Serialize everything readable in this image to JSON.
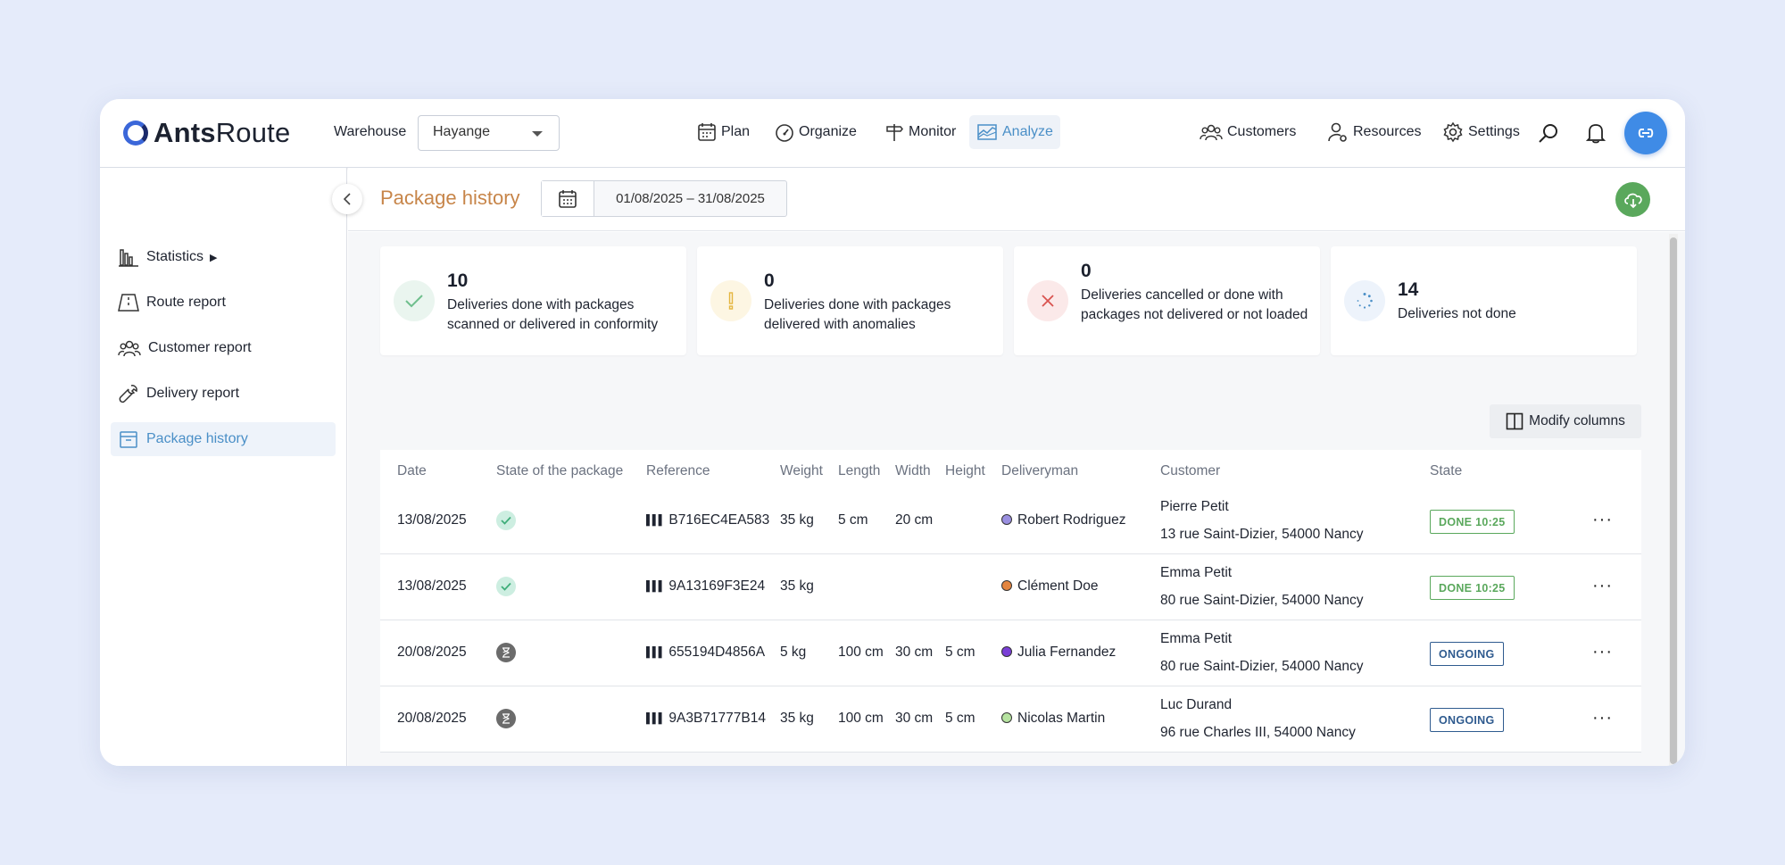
{
  "app": {
    "logo_bold": "Ants",
    "logo_light": "Route"
  },
  "header": {
    "warehouse_label": "Warehouse",
    "warehouse_value": "Hayange",
    "nav": [
      {
        "label": "Plan",
        "icon": "calendar-icon"
      },
      {
        "label": "Organize",
        "icon": "gauge-icon"
      },
      {
        "label": "Monitor",
        "icon": "signpost-icon"
      },
      {
        "label": "Analyze",
        "icon": "chart-icon"
      }
    ],
    "right_nav": [
      {
        "label": "Customers",
        "icon": "users-icon"
      },
      {
        "label": "Resources",
        "icon": "user-gear-icon"
      },
      {
        "label": "Settings",
        "icon": "gear-icon"
      }
    ],
    "avatar_icon": "link-icon"
  },
  "sidebar": {
    "items": [
      {
        "label": "Statistics",
        "icon": "bar-chart-icon",
        "has_submenu": true
      },
      {
        "label": "Route report",
        "icon": "road-icon"
      },
      {
        "label": "Customer report",
        "icon": "users-icon"
      },
      {
        "label": "Delivery report",
        "icon": "wrench-icon"
      },
      {
        "label": "Package history",
        "icon": "package-icon",
        "active": true
      }
    ],
    "submenu_marker": "▶"
  },
  "page": {
    "title": "Package history",
    "date_range": "01/08/2025 – 31/08/2025"
  },
  "summary": [
    {
      "value": "10",
      "text": "Deliveries done with packages scanned or delivered in conformity",
      "icon": "check-icon",
      "color": "#5aa85c"
    },
    {
      "value": "0",
      "text": "Deliveries done with packages delivered with anomalies",
      "icon": "exclamation-icon",
      "color": "#e4b640"
    },
    {
      "value": "0",
      "text": "Deliveries cancelled or done with packages not delivered or not loaded",
      "icon": "cross-icon",
      "color": "#d9534f"
    },
    {
      "value": "14",
      "text": "Deliveries not done",
      "icon": "loading-icon",
      "color": "#4a8fc7"
    }
  ],
  "modify_columns_label": "Modify columns",
  "table": {
    "columns": [
      "Date",
      "State of the package",
      "Reference",
      "Weight",
      "Length",
      "Width",
      "Height",
      "Deliveryman",
      "Customer",
      "State"
    ],
    "rows": [
      {
        "date": "13/08/2025",
        "pkg_state": "ok",
        "reference": "B716EC4EA583",
        "weight": "35 kg",
        "length": "5 cm",
        "width": "20 cm",
        "height": "",
        "deliveryman": "Robert Rodriguez",
        "dot_color": "#9a8fe0",
        "customer_name": "Pierre Petit",
        "customer_address": "13 rue Saint-Dizier, 54000 Nancy",
        "state": "DONE 10:25",
        "state_type": "done"
      },
      {
        "date": "13/08/2025",
        "pkg_state": "ok",
        "reference": "9A13169F3E24",
        "weight": "35 kg",
        "length": "",
        "width": "",
        "height": "",
        "deliveryman": "Clément Doe",
        "dot_color": "#e3853f",
        "customer_name": "Emma Petit",
        "customer_address": "80 rue Saint-Dizier, 54000 Nancy",
        "state": "DONE 10:25",
        "state_type": "done"
      },
      {
        "date": "20/08/2025",
        "pkg_state": "waiting",
        "reference": "655194D4856A",
        "weight": "5 kg",
        "length": "100 cm",
        "width": "30 cm",
        "height": "5 cm",
        "deliveryman": "Julia Fernandez",
        "dot_color": "#7a3fd6",
        "customer_name": "Emma Petit",
        "customer_address": "80 rue Saint-Dizier, 54000 Nancy",
        "state": "ONGOING",
        "state_type": "ongoing"
      },
      {
        "date": "20/08/2025",
        "pkg_state": "waiting",
        "reference": "9A3B71777B14",
        "weight": "35 kg",
        "length": "100 cm",
        "width": "30 cm",
        "height": "5 cm",
        "deliveryman": "Nicolas Martin",
        "dot_color": "#b6e3a0",
        "customer_name": "Luc Durand",
        "customer_address": "96 rue Charles III, 54000 Nancy",
        "state": "ONGOING",
        "state_type": "ongoing"
      }
    ],
    "more_glyph": "···"
  }
}
